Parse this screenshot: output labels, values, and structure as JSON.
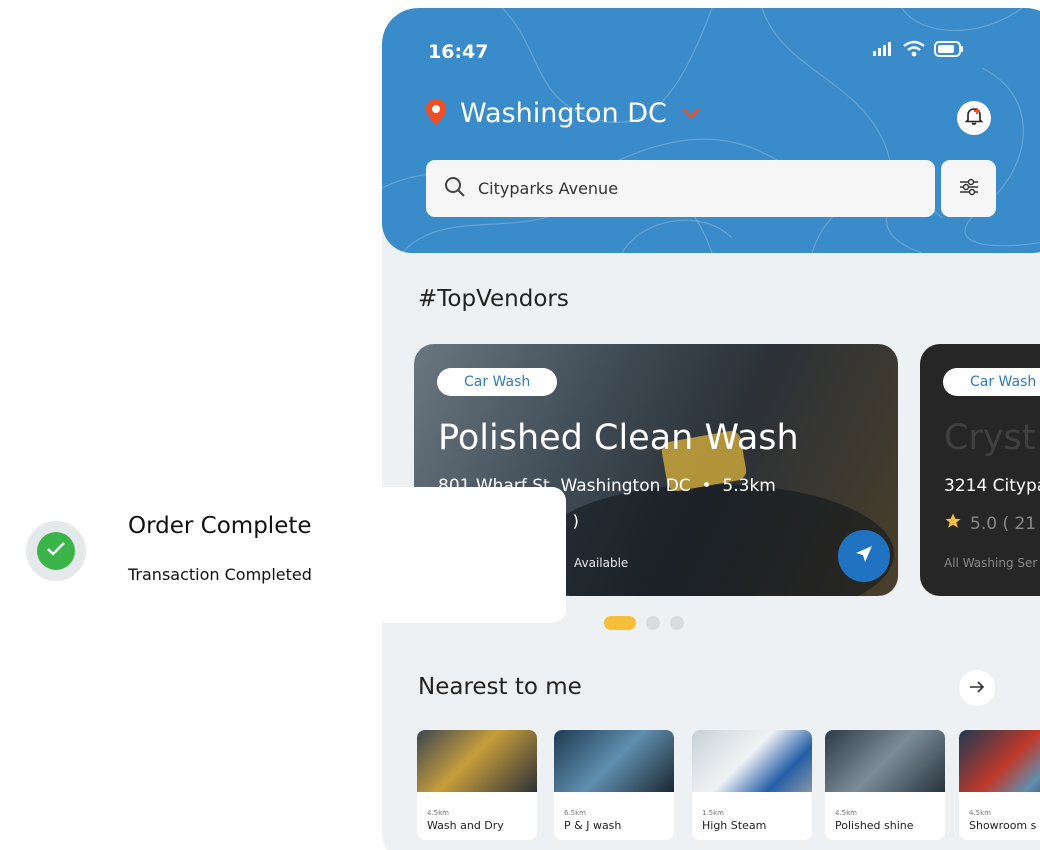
{
  "status_bar": {
    "time": "16:47"
  },
  "location": {
    "city": "Washington DC"
  },
  "search": {
    "placeholder": "Cityparks Avenue"
  },
  "sections": {
    "top_vendors": "#TopVendors",
    "nearest": "Nearest to me"
  },
  "vendors": [
    {
      "category": "Car Wash",
      "name": "Polished Clean Wash",
      "address": "801 Wharf St, Washington DC",
      "distance": "5.3km",
      "reviews_fragment": "iews )",
      "services_fragment": "Available"
    },
    {
      "category": "Car Wash",
      "name_fragment": "Cryst",
      "address_fragment": "3214 Citypa",
      "rating_fragment": "5.0 ( 21",
      "services_fragment": "All Washing Ser"
    }
  ],
  "carousel": {
    "total": 3,
    "active_index": 0
  },
  "nearest": [
    {
      "distance": "4.5km",
      "name": "Wash and Dry"
    },
    {
      "distance": "6.5km",
      "name": "P & J wash"
    },
    {
      "distance": "1.5km",
      "name": "High Steam"
    },
    {
      "distance": "4.5km",
      "name": "Polished shine"
    },
    {
      "distance": "4.5km",
      "name": "Showroom s"
    }
  ],
  "toast": {
    "title": "Order Complete",
    "subtitle": "Transaction Completed"
  },
  "colors": {
    "header": "#3a8bc9",
    "accent_blue": "#1f73c0",
    "pin_red": "#f04e23",
    "active_dot": "#f5bf3a",
    "success_green": "#3bb44a",
    "star": "#f5bf3a"
  },
  "icons": {
    "location": "location-pin-icon",
    "dropdown": "chevron-down-icon",
    "notification": "bell-add-icon",
    "search": "search-icon",
    "filter": "filter-sliders-icon",
    "navigate": "navigation-arrow-icon",
    "next": "arrow-right-icon",
    "success": "checkmark-icon",
    "rating": "star-icon"
  }
}
